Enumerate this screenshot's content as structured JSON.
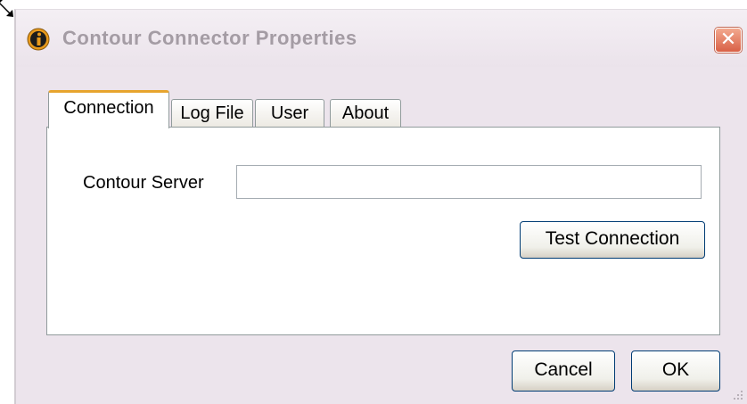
{
  "window": {
    "title": "Contour Connector Properties",
    "close_symbol": "✕"
  },
  "tabs": [
    {
      "label": "Connection",
      "active": true
    },
    {
      "label": "Log File",
      "active": false
    },
    {
      "label": "User",
      "active": false
    },
    {
      "label": "About",
      "active": false
    }
  ],
  "connection": {
    "server_label": "Contour Server",
    "server_value": "",
    "test_button": "Test Connection"
  },
  "footer": {
    "cancel_label": "Cancel",
    "ok_label": "OK"
  },
  "icons": {
    "app": "info-icon",
    "cursor": "resize-cursor-icon",
    "close": "close-icon",
    "grip": "resize-grip-icon"
  },
  "colors": {
    "window_bg": "#ece4ec",
    "close_button": "#d96046",
    "active_tab_accent": "#e7a42e",
    "button_border": "#003c74"
  }
}
